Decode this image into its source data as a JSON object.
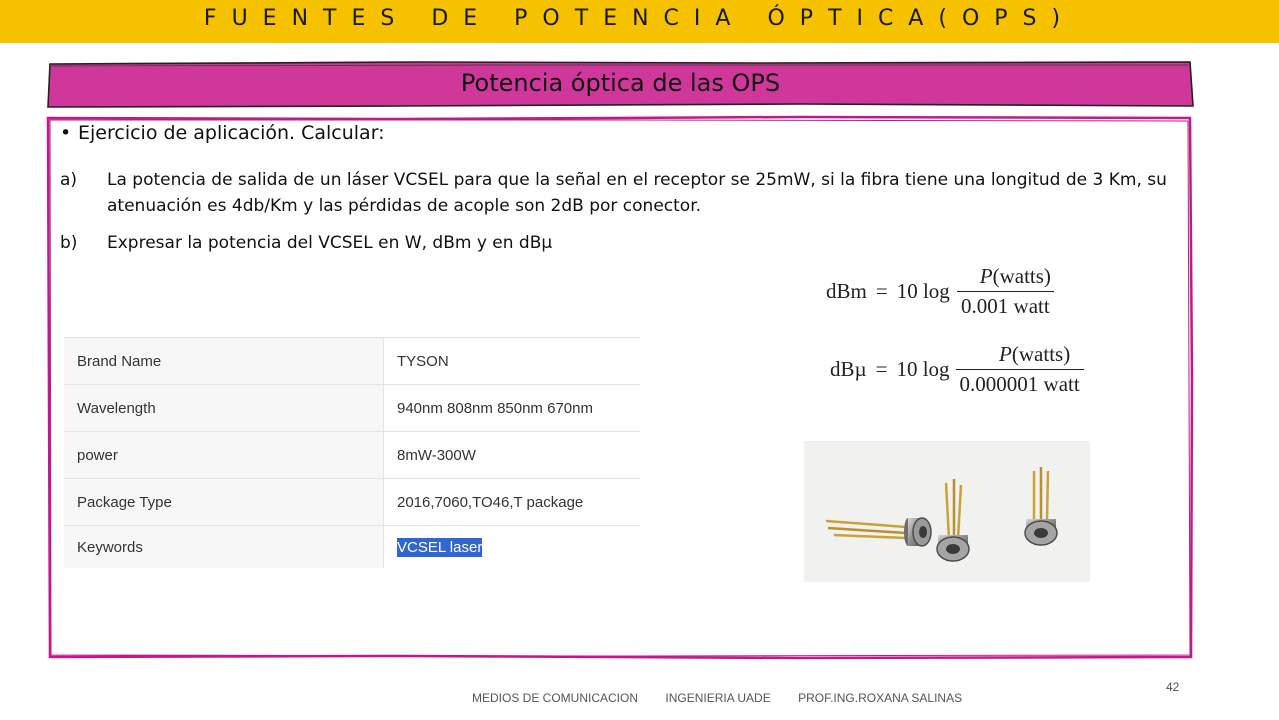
{
  "header": {
    "title": "FUENTES DE POTENCIA ÓPTICA(OPS)"
  },
  "banner": {
    "title": "Potencia óptica de las OPS"
  },
  "content": {
    "bullet": "Ejercicio de aplicación. Calcular:",
    "items": [
      {
        "label": "a)",
        "text": "La potencia de salida de un láser VCSEL para que la señal en el receptor se 25mW, si la fibra tiene una longitud de 3 Km, su atenuación es  4db/Km y las pérdidas de acople son 2dB por conector."
      },
      {
        "label": "b)",
        "text": "Expresar la potencia del VCSEL en W, dBm y en dBµ"
      }
    ]
  },
  "table": {
    "rows": [
      {
        "key": "Brand Name",
        "value": "TYSON"
      },
      {
        "key": "Wavelength",
        "value": "940nm 808nm 850nm 670nm"
      },
      {
        "key": "power",
        "value": "8mW-300W"
      },
      {
        "key": "Package Type",
        "value": "2016,7060,TO46,T package"
      },
      {
        "key": "Keywords",
        "value": "VCSEL laser"
      }
    ]
  },
  "formulas": [
    {
      "lhs": "dBm",
      "eq": "=",
      "coef": "10 log",
      "num_p": "P",
      "num_rest": "(watts)",
      "den": "0.001 watt"
    },
    {
      "lhs": "dBµ",
      "eq": "=",
      "coef": "10 log",
      "num_p": "P",
      "num_rest": "(watts)",
      "den": "0.000001 watt"
    }
  ],
  "footer": {
    "course": "MEDIOS DE COMUNICACION",
    "school": "INGENIERIA  UADE",
    "professor": "PROF.ING.ROXANA SALINAS",
    "page": "42"
  },
  "colors": {
    "header_bg": "#f6c200",
    "banner_bg": "#d0379a",
    "frame": "#c2188a",
    "highlight": "#3166d0"
  }
}
